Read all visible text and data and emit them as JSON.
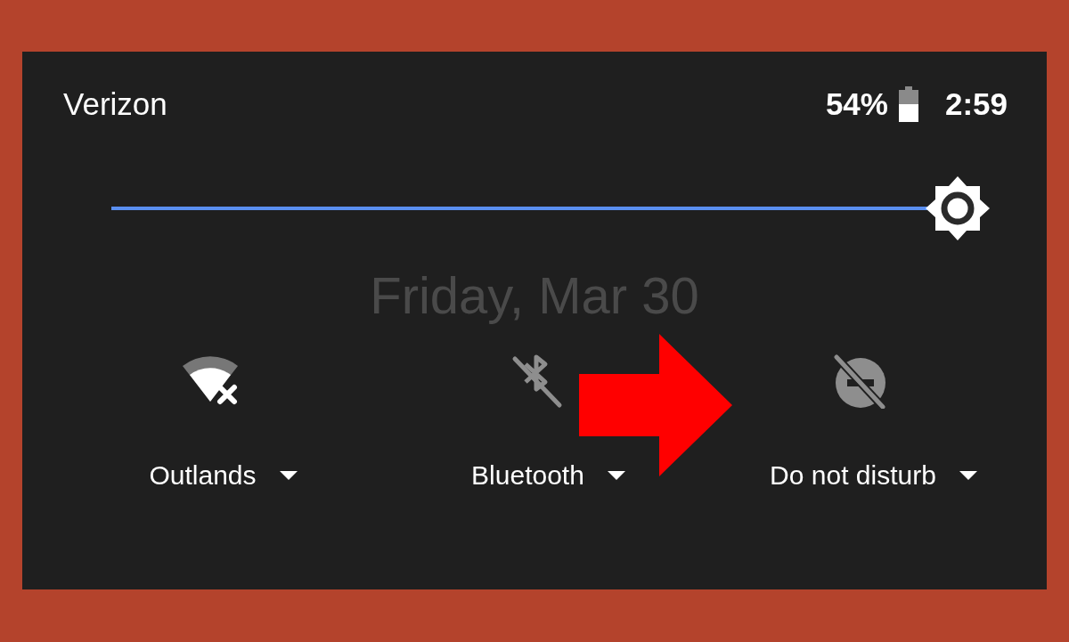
{
  "status_bar": {
    "carrier": "Verizon",
    "battery": "54%",
    "time": "2:59"
  },
  "brightness": {
    "level": 1
  },
  "date": "Friday, Mar 30",
  "tiles": [
    {
      "kind": "wifi",
      "label": "Outlands",
      "on": true
    },
    {
      "kind": "bluetooth",
      "label": "Bluetooth",
      "on": false
    },
    {
      "kind": "dnd",
      "label": "Do not disturb",
      "on": false
    }
  ]
}
